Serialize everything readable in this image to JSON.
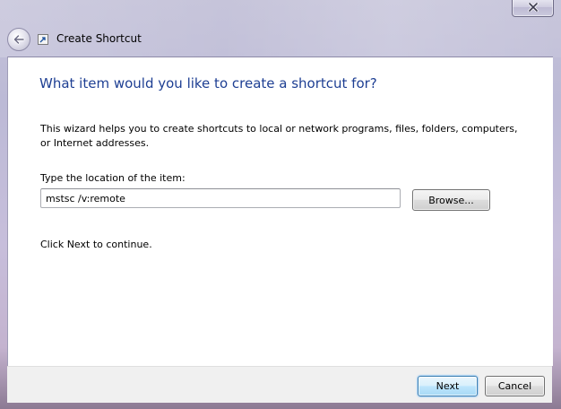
{
  "window": {
    "title": "Create Shortcut",
    "close_label": "x"
  },
  "wizard": {
    "heading": "What item would you like to create a shortcut for?",
    "description": "This wizard helps you to create shortcuts to local or network programs, files, folders, computers, or Internet addresses.",
    "location_label": "Type the location of the item:",
    "location_value": "mstsc /v:remote",
    "browse_label": "Browse...",
    "hint": "Click Next to continue."
  },
  "footer": {
    "next_label": "Next",
    "cancel_label": "Cancel"
  },
  "icons": {
    "back": "back-arrow-icon",
    "close": "close-icon",
    "title": "shortcut-icon"
  },
  "colors": {
    "heading": "#1e3f93",
    "frame": "#c3c1d8",
    "default_button_border": "#3c7fb1"
  }
}
